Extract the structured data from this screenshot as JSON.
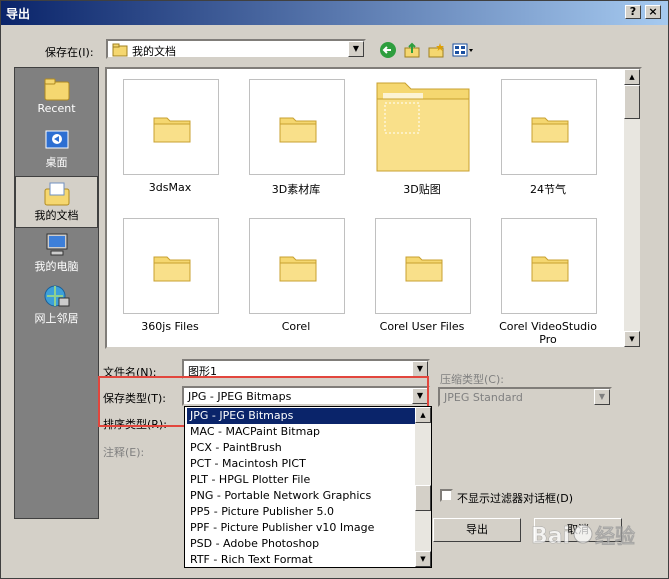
{
  "window": {
    "title": "导出",
    "help_btn": "?",
    "close_btn": "×"
  },
  "save_in": {
    "label": "保存在(I):",
    "value": "我的文档"
  },
  "places": [
    {
      "label": "Recent",
      "icon": "recent-folder-icon"
    },
    {
      "label": "桌面",
      "icon": "desktop-icon"
    },
    {
      "label": "我的文档",
      "icon": "my-documents-icon"
    },
    {
      "label": "我的电脑",
      "icon": "my-computer-icon"
    },
    {
      "label": "网上邻居",
      "icon": "network-icon"
    }
  ],
  "files": [
    {
      "name": "3dsMax"
    },
    {
      "name": "3D素材库"
    },
    {
      "name": "3D贴图"
    },
    {
      "name": "24节气"
    },
    {
      "name": "360js Files"
    },
    {
      "name": "Corel"
    },
    {
      "name": "Corel User Files"
    },
    {
      "name": "Corel VideoStudio Pro"
    }
  ],
  "form": {
    "filename_label": "文件名(N):",
    "filename_value": "图形1",
    "savetype_label": "保存类型(T):",
    "savetype_value": "JPG - JPEG Bitmaps",
    "sorttype_label": "排序类型(R):",
    "notes_label": "注释(E):",
    "compression_label": "压缩类型(C):",
    "compression_value": "JPEG Standard",
    "no_filter_dialog_label": "不显示过滤器对话框(D)"
  },
  "dropdown": {
    "items": [
      "JPG - JPEG Bitmaps",
      "MAC - MACPaint Bitmap",
      "PCX - PaintBrush",
      "PCT - Macintosh PICT",
      "PLT - HPGL Plotter File",
      "PNG - Portable Network Graphics",
      "PP5 - Picture Publisher 5.0",
      "PPF - Picture Publisher v10 Image",
      "PSD - Adobe Photoshop",
      "RTF - Rich Text Format"
    ],
    "selected_index": 0
  },
  "buttons": {
    "export": "导出",
    "cancel": "取消"
  },
  "watermark": {
    "text": "Bai经验"
  },
  "colors": {
    "titlebar": "#0a246a",
    "highlight": "#0a246a",
    "annotation_red": "#e2463d",
    "folder_yellow": "#f5d770"
  }
}
